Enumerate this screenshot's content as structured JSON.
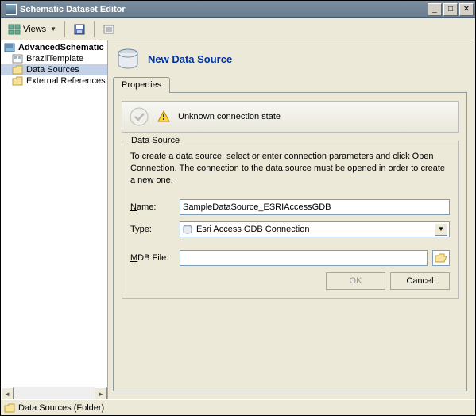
{
  "window": {
    "title": "Schematic Dataset Editor"
  },
  "toolbar": {
    "views_label": "Views"
  },
  "tree": {
    "root": "AdvancedSchematic",
    "items": [
      {
        "label": "BrazilTemplate"
      },
      {
        "label": "Data Sources"
      },
      {
        "label": "External References"
      }
    ]
  },
  "status": {
    "text": "Data Sources (Folder)"
  },
  "header": {
    "title": "New Data Source"
  },
  "tabs": {
    "properties": "Properties"
  },
  "connection_status": {
    "text": "Unknown connection state"
  },
  "fieldset": {
    "legend": "Data Source",
    "description": "To create a data source, select or enter connection parameters and click Open Connection.  The connection to the data source must be opened in order to create a new one.",
    "name_label": "Name:",
    "name_value": "SampleDataSource_ESRIAccessGDB",
    "type_label": "Type:",
    "type_value": "Esri Access GDB Connection",
    "mdb_label": "MDB File:",
    "mdb_value": "",
    "ok_label": "OK",
    "cancel_label": "Cancel"
  }
}
